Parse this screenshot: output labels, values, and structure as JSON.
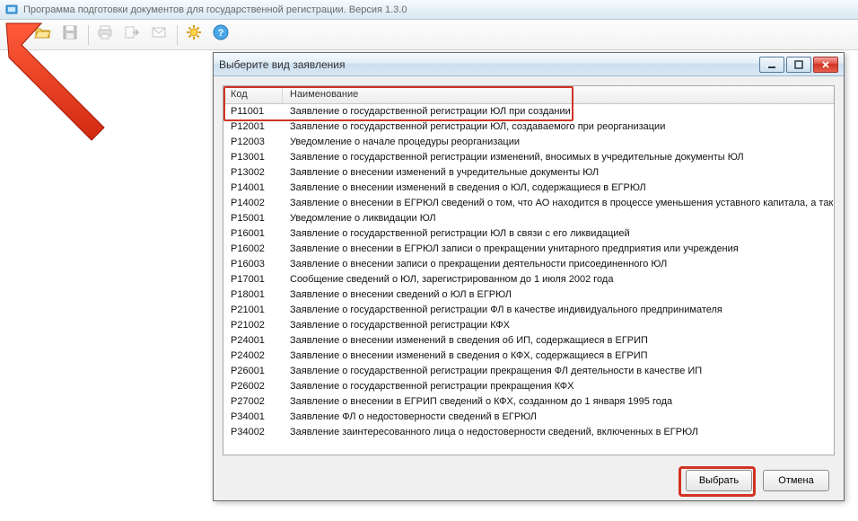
{
  "app": {
    "title": "Программа подготовки документов для государственной регистрации. Версия 1.3.0"
  },
  "toolbar": {
    "items": [
      {
        "name": "new-icon",
        "interactable": true,
        "disabled": false
      },
      {
        "name": "open-icon",
        "interactable": true,
        "disabled": false
      },
      {
        "name": "save-icon",
        "interactable": false,
        "disabled": true
      },
      {
        "sep": true
      },
      {
        "name": "print-icon",
        "interactable": false,
        "disabled": true
      },
      {
        "name": "export-icon",
        "interactable": false,
        "disabled": true
      },
      {
        "name": "mail-icon",
        "interactable": false,
        "disabled": true
      },
      {
        "sep": true
      },
      {
        "name": "settings-icon",
        "interactable": true,
        "disabled": false
      },
      {
        "name": "help-icon",
        "interactable": true,
        "disabled": false
      }
    ]
  },
  "dialog": {
    "title": "Выберите вид заявления",
    "columns": {
      "code": "Код",
      "name": "Наименование"
    },
    "rows": [
      {
        "code": "Р11001",
        "name": "Заявление о государственной регистрации ЮЛ при создании"
      },
      {
        "code": "Р12001",
        "name": "Заявление о государственной регистрации ЮЛ, создаваемого при реорганизации"
      },
      {
        "code": "Р12003",
        "name": "Уведомление о начале процедуры реорганизации"
      },
      {
        "code": "Р13001",
        "name": "Заявление о государственной регистрации изменений, вносимых в учредительные документы ЮЛ"
      },
      {
        "code": "Р13002",
        "name": "Заявление о внесении изменений в учредительные документы ЮЛ"
      },
      {
        "code": "Р14001",
        "name": "Заявление о внесении изменений в сведения о ЮЛ, содержащиеся в ЕГРЮЛ"
      },
      {
        "code": "Р14002",
        "name": "Заявление о внесении в ЕГРЮЛ сведений о том, что АО находится в процессе уменьшения уставного капитала, а так..."
      },
      {
        "code": "Р15001",
        "name": "Уведомление о ликвидации ЮЛ"
      },
      {
        "code": "Р16001",
        "name": "Заявление о государственной регистрации ЮЛ в связи с его ликвидацией"
      },
      {
        "code": "Р16002",
        "name": "Заявление о внесении в ЕГРЮЛ записи о прекращении унитарного предприятия или учреждения"
      },
      {
        "code": "Р16003",
        "name": "Заявление о внесении записи о прекращении деятельности присоединенного ЮЛ"
      },
      {
        "code": "Р17001",
        "name": "Сообщение сведений о ЮЛ, зарегистрированном до 1 июля 2002 года"
      },
      {
        "code": "Р18001",
        "name": "Заявление о внесении сведений о ЮЛ в ЕГРЮЛ"
      },
      {
        "code": "Р21001",
        "name": "Заявление о государственной регистрации ФЛ в качестве индивидуального предпринимателя"
      },
      {
        "code": "Р21002",
        "name": "Заявление о государственной регистрации КФХ"
      },
      {
        "code": "Р24001",
        "name": "Заявление о внесении изменений в сведения об ИП, содержащиеся в ЕГРИП"
      },
      {
        "code": "Р24002",
        "name": "Заявление о внесении изменений в сведения о КФХ, содержащиеся в ЕГРИП"
      },
      {
        "code": "Р26001",
        "name": "Заявление о государственной регистрации прекращения ФЛ деятельности в качестве ИП"
      },
      {
        "code": "Р26002",
        "name": "Заявление о государственной регистрации прекращения КФХ"
      },
      {
        "code": "Р27002",
        "name": "Заявление о внесении в ЕГРИП сведений о КФХ, созданном до 1 января 1995 года"
      },
      {
        "code": "Р34001",
        "name": "Заявление ФЛ о недостоверности сведений в ЕГРЮЛ"
      },
      {
        "code": "Р34002",
        "name": "Заявление заинтересованного лица о недостоверности сведений, включенных в ЕГРЮЛ"
      }
    ],
    "buttons": {
      "select": "Выбрать",
      "cancel": "Отмена"
    }
  }
}
